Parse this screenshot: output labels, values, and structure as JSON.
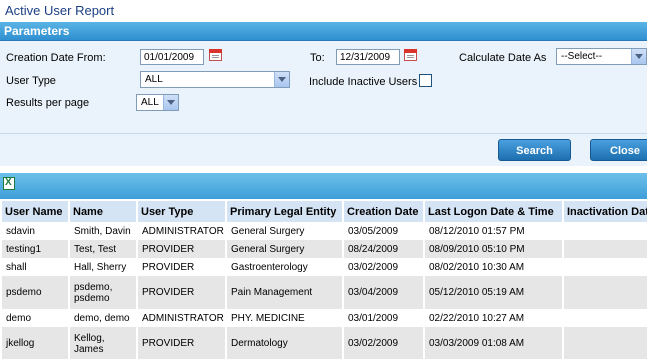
{
  "title": "Active User Report",
  "parameters": {
    "header": "Parameters",
    "creation_date_from_label": "Creation Date From:",
    "creation_date_from": "01/01/2009",
    "to_label": "To:",
    "to_date": "12/31/2009",
    "calculate_date_as_label": "Calculate Date As",
    "calculate_date_as_value": "--Select--",
    "user_type_label": "User Type",
    "user_type_value": "ALL",
    "include_inactive_label": "Include Inactive Users",
    "results_per_page_label": "Results per page",
    "results_per_page_value": "ALL"
  },
  "buttons": {
    "search": "Search",
    "close": "Close"
  },
  "table": {
    "columns": [
      "User Name",
      "Name",
      "User Type",
      "Primary Legal Entity",
      "Creation Date",
      "Last Logon Date & Time",
      "Inactivation Date"
    ],
    "rows": [
      [
        "sdavin",
        "Smith, Davin",
        "ADMINISTRATOR",
        "General Surgery",
        "03/05/2009",
        "08/12/2010 01:57 PM",
        ""
      ],
      [
        "testing1",
        "Test, Test",
        "PROVIDER",
        "General Surgery",
        "08/24/2009",
        "08/09/2010 05:10 PM",
        ""
      ],
      [
        "shall",
        "Hall, Sherry",
        "PROVIDER",
        "Gastroenterology",
        "03/02/2009",
        "08/02/2010 10:30 AM",
        ""
      ],
      [
        "psdemo",
        "psdemo, psdemo",
        "PROVIDER",
        "Pain Management",
        "03/04/2009",
        "05/12/2010 05:19 AM",
        ""
      ],
      [
        "demo",
        "demo, demo",
        "ADMINISTRATOR",
        "PHY. MEDICINE",
        "03/01/2009",
        "02/22/2010 10:27 AM",
        ""
      ],
      [
        "jkellog",
        "Kellog, James",
        "PROVIDER",
        "Dermatology",
        "03/02/2009",
        "03/03/2009 01:08 AM",
        ""
      ]
    ]
  }
}
